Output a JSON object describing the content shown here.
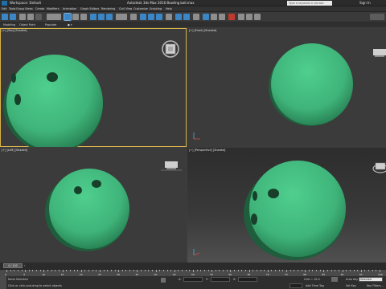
{
  "titlebar": {
    "workspace": "Workspace: Default",
    "app_title": "Autodesk 3ds Max 2016    Bowling ball.max",
    "search_placeholder": "Type a keyword or phrase",
    "sign_in": "Sign In"
  },
  "menu": [
    "Edit",
    "Tools",
    "Group",
    "Views",
    "Create",
    "Modifiers",
    "Animation",
    "Graph Editors",
    "Rendering",
    "Civil View",
    "Customize",
    "Scripting",
    "Help"
  ],
  "ribbon": {
    "a": "Modeling",
    "b": "Object Paint",
    "c": "Populate"
  },
  "viewports": {
    "top": "[+] [Top] [Shaded]",
    "front": "[+] [Front] [Shaded]",
    "left": "[+] [Left] [Shaded]",
    "perspective": "[+] [Perspective] [Shaded]"
  },
  "colors": {
    "ball": "#3fb47a",
    "ball_dark": "#1f6e45",
    "active_border": "#d8b34a"
  },
  "timeline": {
    "position": "0 / 100",
    "ticks": [
      "0",
      "5",
      "10",
      "15",
      "20",
      "25",
      "30",
      "35",
      "40",
      "45",
      "50",
      "55",
      "60",
      "65",
      "70",
      "75",
      "80",
      "85",
      "90",
      "95",
      "100"
    ]
  },
  "status": {
    "selection": "None Selected",
    "prompt": "Click or click-and-drag to select objects",
    "x_label": "X:",
    "y_label": "Y:",
    "z_label": "Z:",
    "grid": "Grid = 10.0",
    "auto_key": "Auto Key",
    "selected": "Selected",
    "set_key": "Set Key",
    "key_filters": "Key Filters...",
    "add_time_tag": "Add Time Tag"
  }
}
